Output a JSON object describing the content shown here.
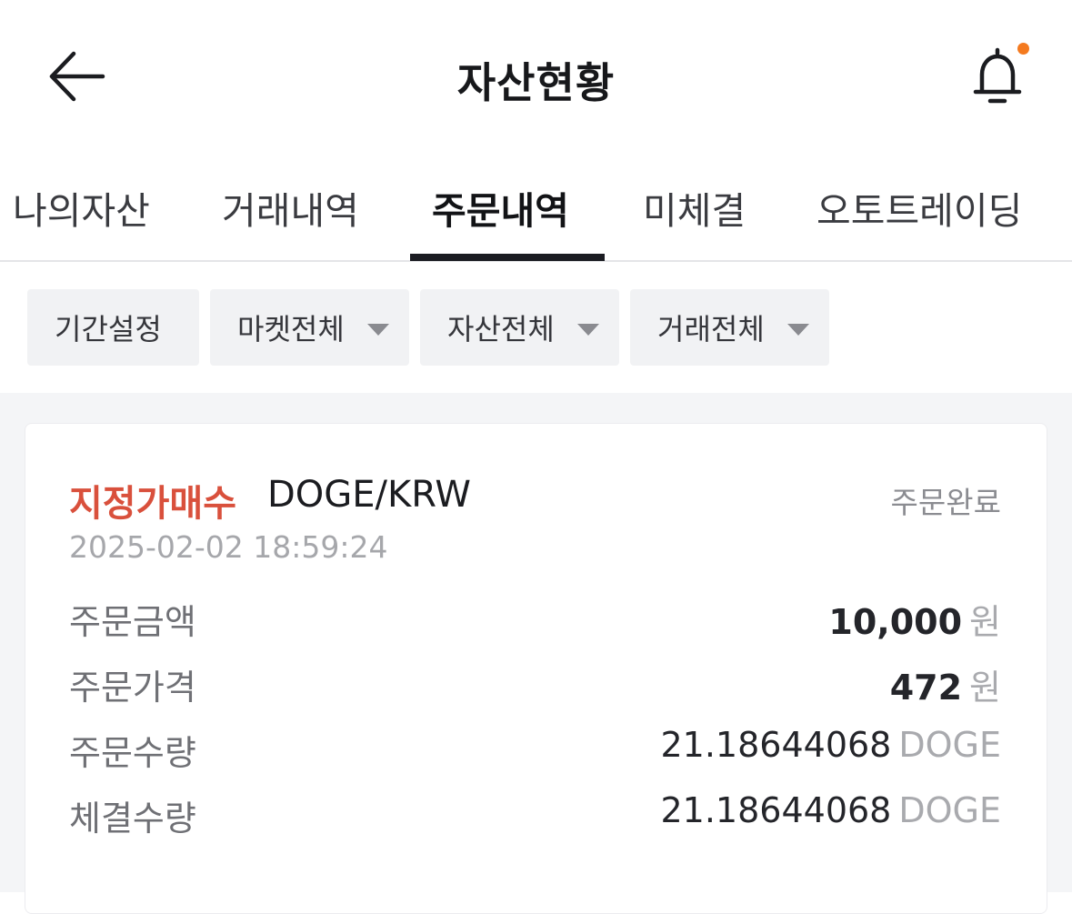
{
  "header": {
    "title": "자산현황",
    "back_icon": "arrow-left-icon",
    "bell_icon": "bell-icon",
    "notification_dot_color": "#f47a1f"
  },
  "tabs": [
    {
      "label": "나의자산",
      "active": false
    },
    {
      "label": "거래내역",
      "active": false
    },
    {
      "label": "주문내역",
      "active": true
    },
    {
      "label": "미체결",
      "active": false
    },
    {
      "label": "오토트레이딩",
      "active": false
    }
  ],
  "filters": [
    {
      "label": "기간설정",
      "has_dropdown": false
    },
    {
      "label": "마켓전체",
      "has_dropdown": true
    },
    {
      "label": "자산전체",
      "has_dropdown": true
    },
    {
      "label": "거래전체",
      "has_dropdown": true
    }
  ],
  "order": {
    "type": "지정가매수",
    "type_color": "#d9503c",
    "pair": "DOGE/KRW",
    "status": "주문완료",
    "timestamp": "2025-02-02 18:59:24",
    "rows": [
      {
        "label": "주문금액",
        "value": "10,000",
        "unit": "원"
      },
      {
        "label": "주문가격",
        "value": "472",
        "unit": "원"
      },
      {
        "label": "주문수량",
        "value": "21.18644068",
        "unit": "DOGE"
      },
      {
        "label": "체결수량",
        "value": "21.18644068",
        "unit": "DOGE"
      }
    ]
  }
}
